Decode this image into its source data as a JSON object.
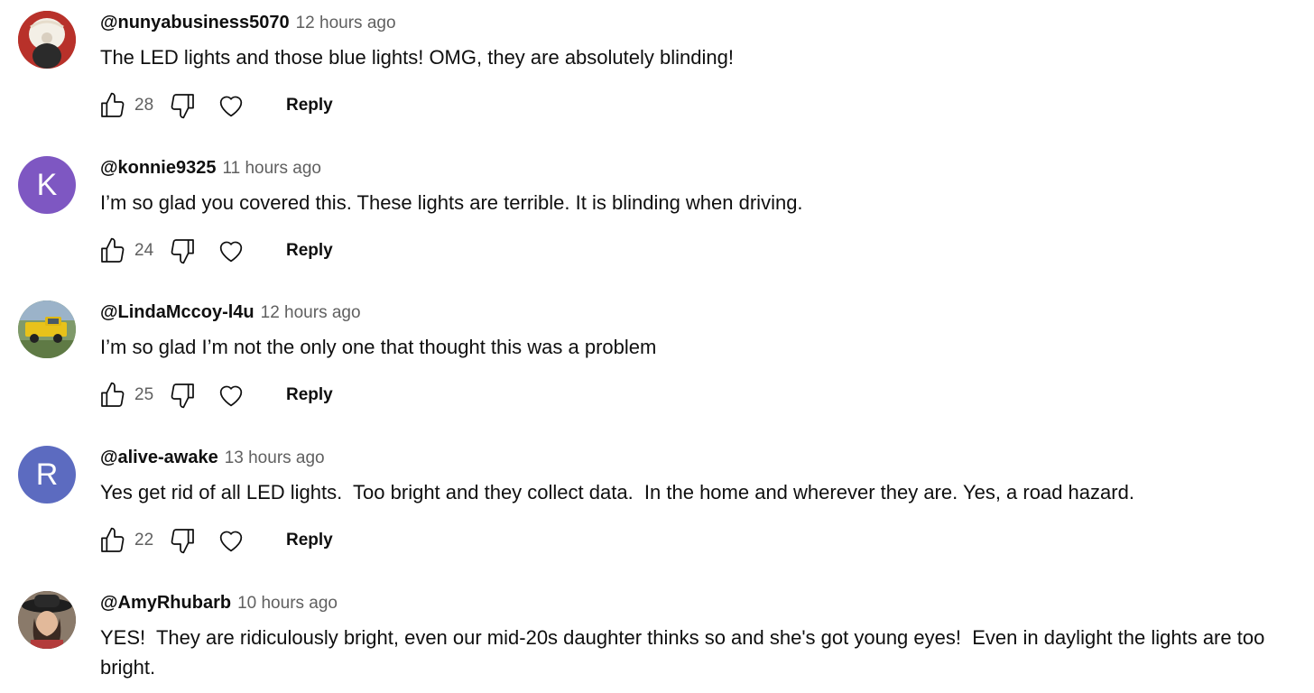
{
  "comments": [
    {
      "author": "@nunyabusiness5070",
      "time": "12 hours ago",
      "text": "The LED lights and those blue lights! OMG, they are absolutely blinding!",
      "likes": "28",
      "reply_label": "Reply",
      "avatar_letter": "",
      "avatar_color": "#c0392b"
    },
    {
      "author": "@konnie9325",
      "time": "11 hours ago",
      "text": "I’m so glad you covered this. These lights are terrible. It is blinding when driving.",
      "likes": "24",
      "reply_label": "Reply",
      "avatar_letter": "K",
      "avatar_color": "#7e57c2"
    },
    {
      "author": "@LindaMccoy-l4u",
      "time": "12 hours ago",
      "text": "I’m so glad I’m not the only one that thought this was a problem",
      "likes": "25",
      "reply_label": "Reply",
      "avatar_letter": "",
      "avatar_color": "#6b8e5a"
    },
    {
      "author": "@alive-awake",
      "time": "13 hours ago",
      "text": "Yes get rid of all LED lights.  Too bright and they collect data.  In the home and wherever they are. Yes, a road hazard.",
      "likes": "22",
      "reply_label": "Reply",
      "avatar_letter": "R",
      "avatar_color": "#5c6bc0"
    },
    {
      "author": "@AmyRhubarb",
      "time": "10 hours ago",
      "text": "YES!  They are ridiculously bright, even our mid-20s daughter thinks so and she's got young eyes!  Even in daylight the lights are too bright.",
      "avatar_letter": "",
      "avatar_color": "#5d4037"
    }
  ]
}
